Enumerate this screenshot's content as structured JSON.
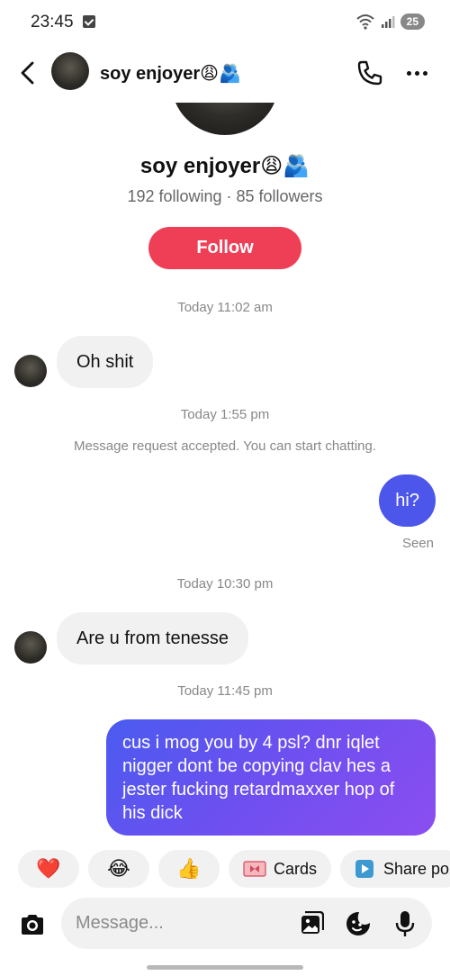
{
  "status_bar": {
    "time": "23:45",
    "battery": "25"
  },
  "header": {
    "name": "soy enjoyer😩🫂"
  },
  "profile": {
    "name": "soy enjoyer😩🫂",
    "stats": "192 following · 85 followers",
    "follow_label": "Follow"
  },
  "conversation": {
    "timestamp_1": "Today 11:02 am",
    "message_1": "Oh shit",
    "timestamp_2": "Today 1:55 pm",
    "system_message": "Message request accepted. You can start chatting.",
    "message_2": "hi?",
    "seen_label": "Seen",
    "timestamp_3": "Today 10:30 pm",
    "message_3": "Are u from tenesse",
    "timestamp_4": "Today 11:45 pm",
    "message_4": "cus i mog you by 4 psl? dnr iqlet nigger dont be copying clav hes a jester fucking retardmaxxer hop of his dick"
  },
  "quick_replies": [
    {
      "label": "❤️",
      "icon": "heart-icon"
    },
    {
      "label": "😂",
      "icon": "laughing-icon"
    },
    {
      "label": "👍",
      "icon": "thumbs-up-icon"
    },
    {
      "label": "Cards",
      "icon": "gift-card-icon"
    },
    {
      "label": "Share po",
      "icon": "share-play-icon"
    }
  ],
  "composer": {
    "placeholder": "Message..."
  },
  "colors": {
    "follow": "#ee3f57",
    "outgoing_bubble": "#4c56ea",
    "incoming_bubble": "#f1f1f2"
  }
}
